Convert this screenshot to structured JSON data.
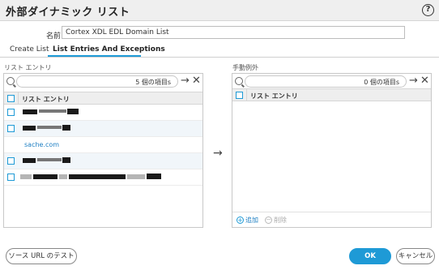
{
  "dialog": {
    "title": "外部ダイナミック リスト",
    "help_icon": "?"
  },
  "name_field": {
    "label": "名前",
    "value": "Cortex XDL EDL Domain List"
  },
  "tabs": [
    {
      "label": "Create List",
      "active": false
    },
    {
      "label": "List Entries And Exceptions",
      "active": true
    }
  ],
  "list_entries": {
    "section_label": "リスト エントリ",
    "count_text": "5 個の項目s",
    "column_header": "リスト エントリ",
    "rows": [
      {
        "text": "",
        "redacted": true
      },
      {
        "text": "",
        "redacted": true
      },
      {
        "text": "sache.com",
        "redacted": false
      },
      {
        "text": "",
        "redacted": true
      },
      {
        "text": "",
        "redacted": true
      }
    ]
  },
  "exceptions": {
    "section_label": "手動例外",
    "count_text": "0 個の項目s",
    "column_header": "リスト エントリ",
    "add_label": "追加",
    "delete_label": "削除"
  },
  "icons": {
    "arrow": "→",
    "close": "✕",
    "plus": "+",
    "minus": "−"
  },
  "buttons": {
    "test_source": "ソース URL のテスト",
    "ok": "OK",
    "cancel": "キャンセル"
  },
  "colors": {
    "accent": "#1e9ad6",
    "link": "#1e7fc3"
  }
}
